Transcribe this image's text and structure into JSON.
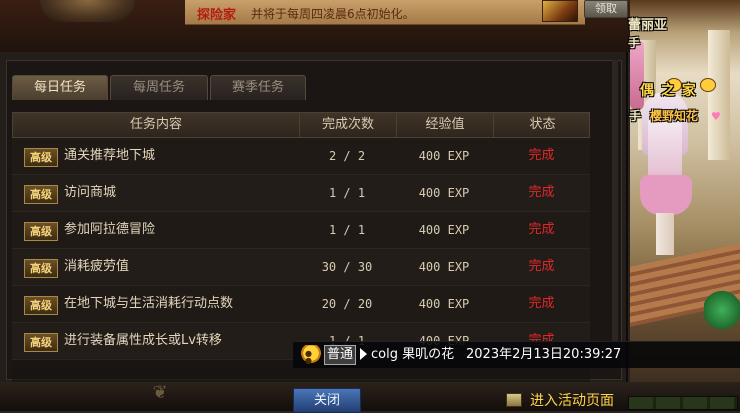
{
  "banner": {
    "title": "探险家",
    "text": "并将于每周四凌晨6点初始化。",
    "claim_label": "领取"
  },
  "tabs": [
    {
      "label": "每日任务",
      "active": true
    },
    {
      "label": "每周任务",
      "active": false
    },
    {
      "label": "赛季任务",
      "active": false
    }
  ],
  "table": {
    "headers": {
      "content": "任务内容",
      "count": "完成次数",
      "exp": "经验值",
      "status": "状态"
    },
    "rows": [
      {
        "badge": "高级",
        "task": "通关推荐地下城",
        "count": "2 / 2",
        "exp": "400 EXP",
        "status": "完成"
      },
      {
        "badge": "高级",
        "task": "访问商城",
        "count": "1 / 1",
        "exp": "400 EXP",
        "status": "完成"
      },
      {
        "badge": "高级",
        "task": "参加阿拉德冒险",
        "count": "1 / 1",
        "exp": "400 EXP",
        "status": "完成"
      },
      {
        "badge": "高级",
        "task": "消耗疲劳值",
        "count": "30 / 30",
        "exp": "400 EXP",
        "status": "完成"
      },
      {
        "badge": "高级",
        "task": "在地下城与生活消耗行动点数",
        "count": "20 / 20",
        "exp": "400 EXP",
        "status": "完成"
      },
      {
        "badge": "高级",
        "task": "进行装备属性成长或Lv转移",
        "count": "1 / 1",
        "exp": "400 EXP",
        "status": "完成"
      }
    ]
  },
  "close_label": "关闭",
  "chat": {
    "channel": "普通",
    "user": "colg 果叽の花",
    "time": "2023年2月13日20:39:27"
  },
  "activity_link": "进入活动页面",
  "scene": {
    "name_tag_1": "蕾丽亚",
    "name_tag_2": "手",
    "guild": "偶 之 家",
    "title_prefix": "手",
    "character_name": "樱野知花"
  },
  "colors": {
    "status_done": "#e0282a",
    "badge_text": "#f3d27a",
    "banner_title": "#b41d10",
    "close_button": "#3a62a4"
  }
}
